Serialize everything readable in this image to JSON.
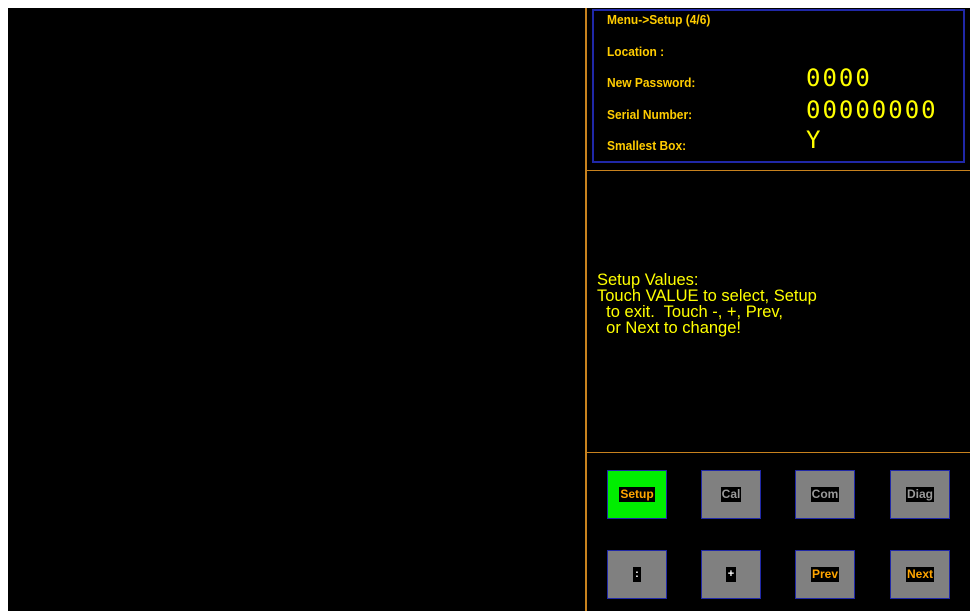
{
  "header": {
    "title": "Menu->Setup (4/6)"
  },
  "fields": [
    {
      "label": "Location :",
      "value": ""
    },
    {
      "label": "New Password:",
      "value": "0000"
    },
    {
      "label": "Serial Number:",
      "value": "00000000"
    },
    {
      "label": "Smallest Box:",
      "value": "Y"
    }
  ],
  "help": {
    "line1": "Setup Values:",
    "line2": "Touch VALUE to select, Setup",
    "line3": "  to exit.  Touch -, +, Prev,",
    "line4": "  or Next to change!"
  },
  "buttons": {
    "setup": "Setup",
    "cal": "Cal",
    "com": "Com",
    "diag": "Diag",
    "minus": ":",
    "plus": "+",
    "prev": "Prev",
    "next": "Next"
  },
  "colors": {
    "background": "#000000",
    "label_text": "#ffcc00",
    "value_text": "#ffff00",
    "divider": "#c8821e",
    "panel_border": "#2028a8",
    "button_face": "#808080",
    "active_button": "#00ee00"
  }
}
